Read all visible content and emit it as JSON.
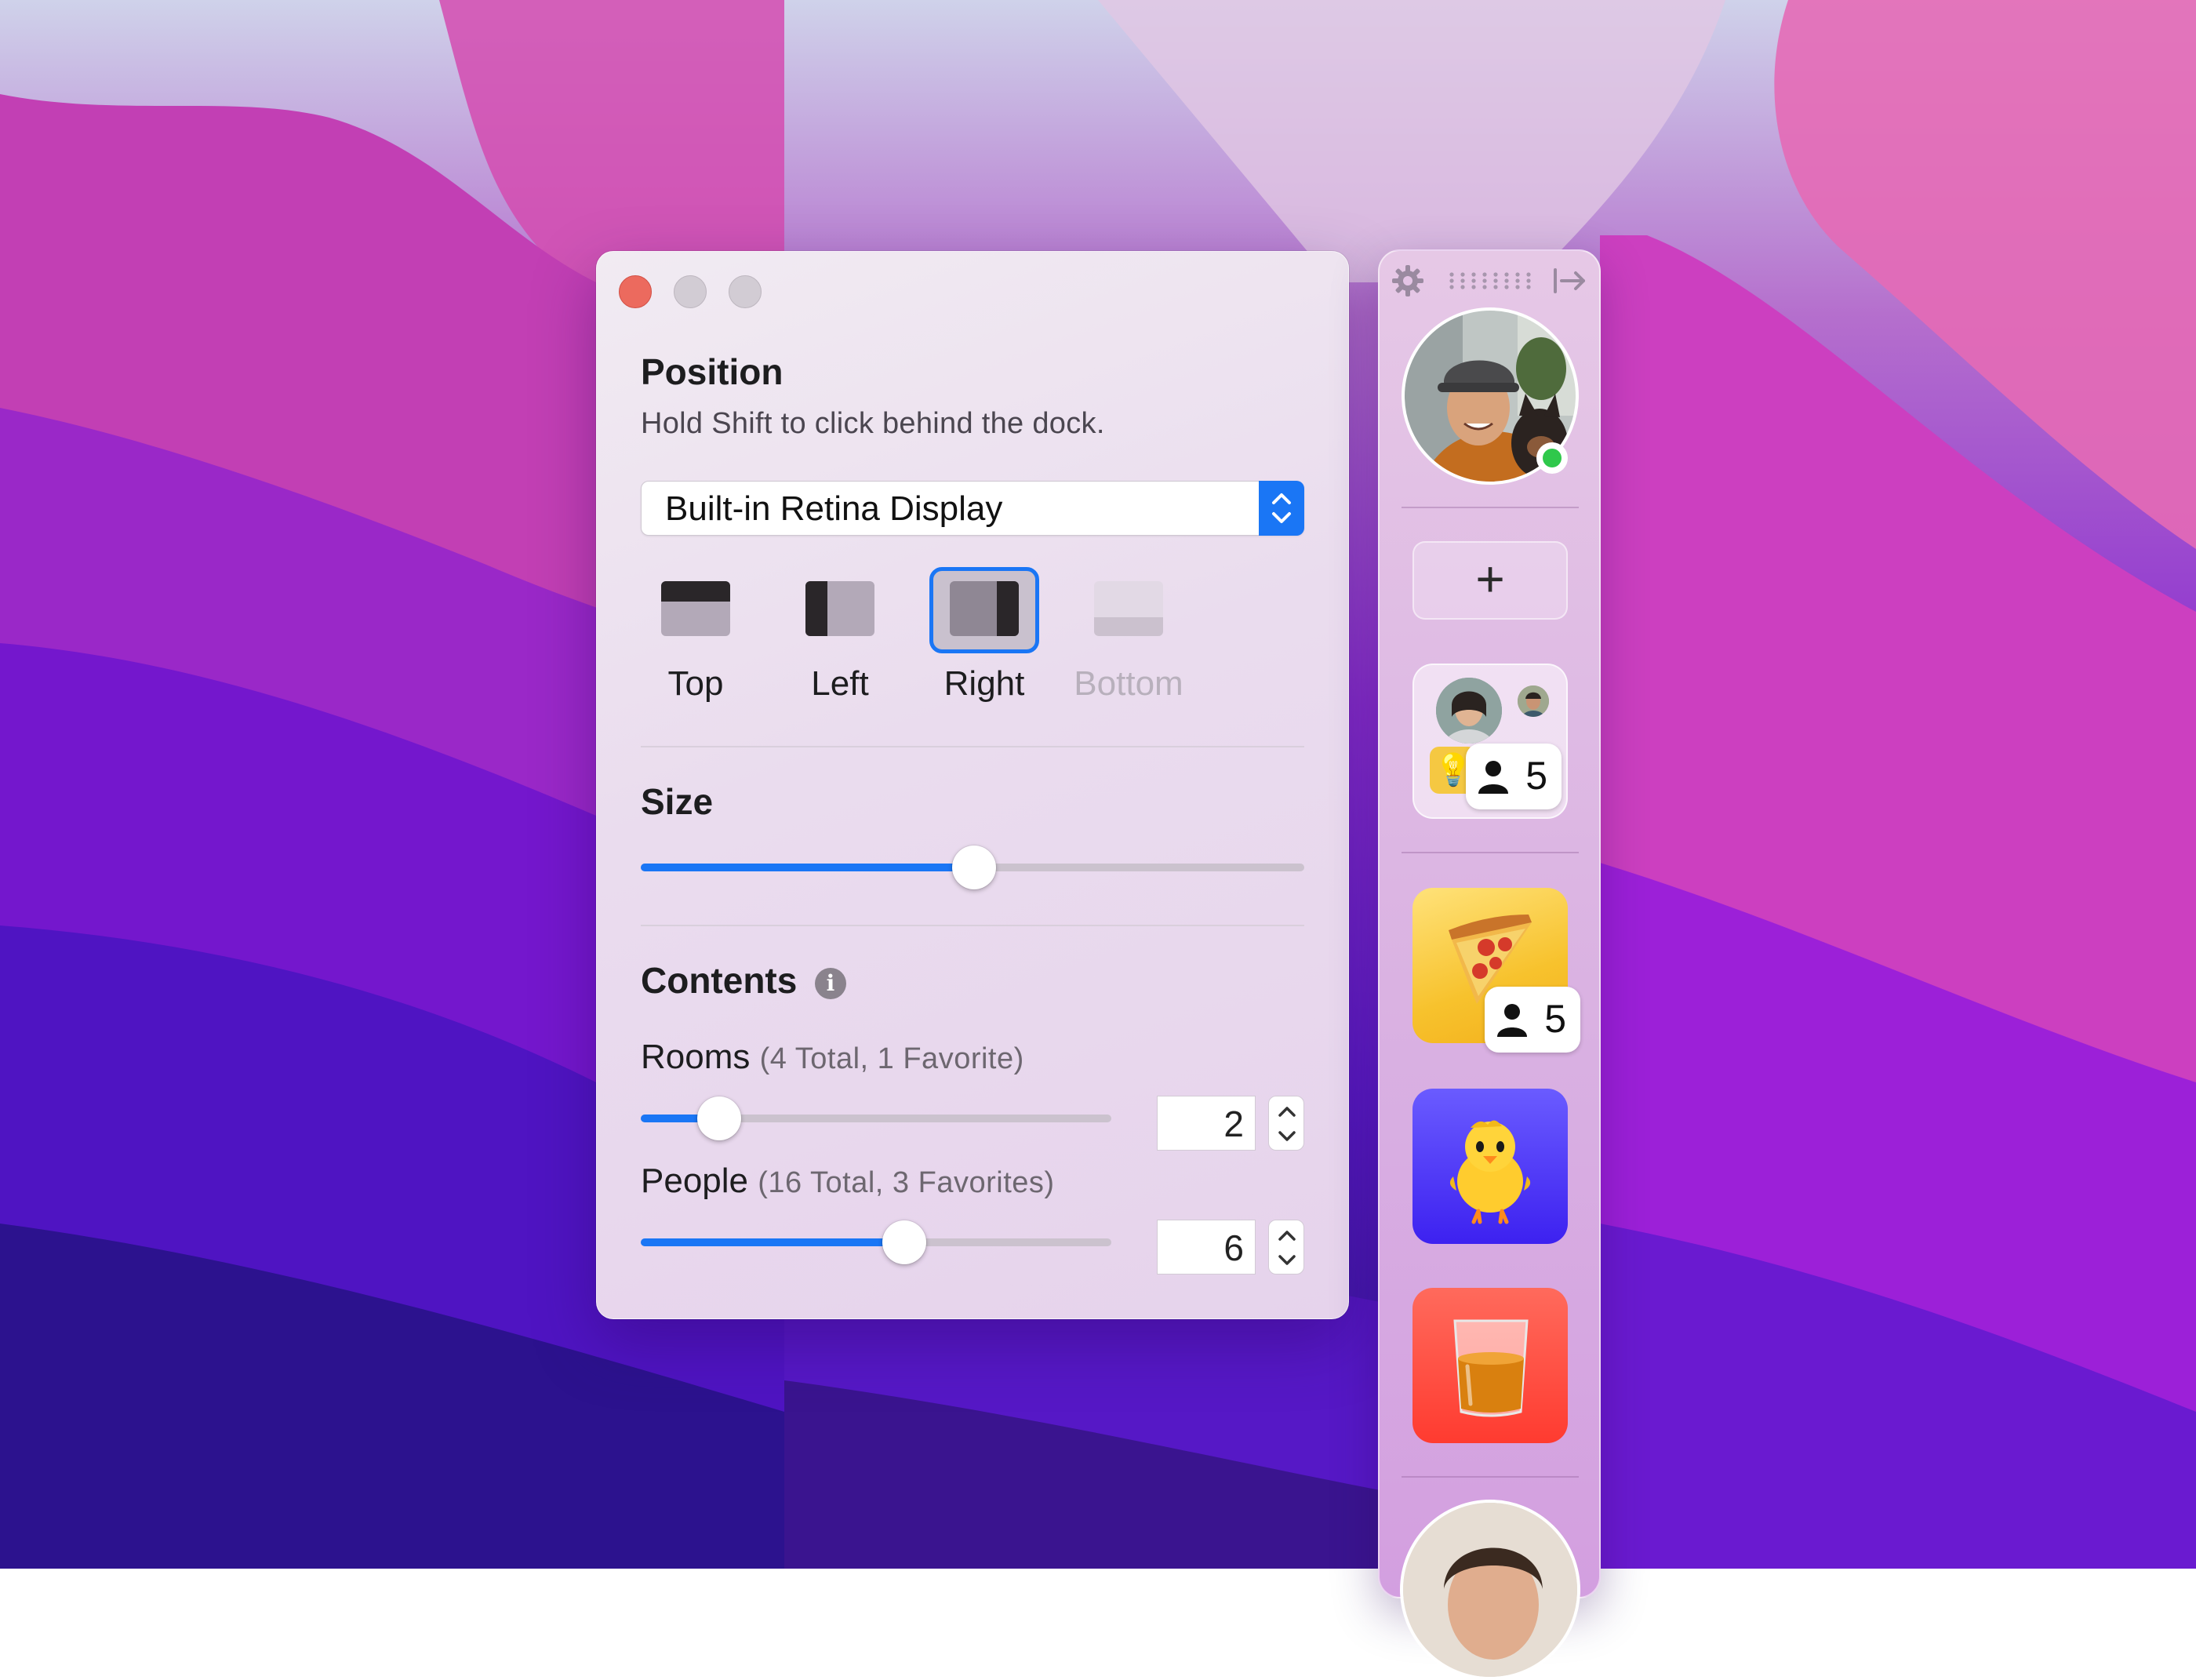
{
  "window": {
    "traffic_lights": [
      "close",
      "minimize",
      "zoom"
    ],
    "position": {
      "title": "Position",
      "subtitle": "Hold Shift to click behind the dock.",
      "display_select": "Built-in Retina Display",
      "options": [
        {
          "label": "Top",
          "state": "normal"
        },
        {
          "label": "Left",
          "state": "normal"
        },
        {
          "label": "Right",
          "state": "selected"
        },
        {
          "label": "Bottom",
          "state": "disabled"
        }
      ]
    },
    "size": {
      "title": "Size",
      "value_fraction": 0.5
    },
    "contents": {
      "title": "Contents",
      "info_icon": "info-icon",
      "rooms": {
        "label": "Rooms",
        "note": "(4 Total, 1 Favorite)",
        "value": "2",
        "slider_fraction": 0.17
      },
      "people": {
        "label": "People",
        "note": "(16 Total, 3 Favorites)",
        "value": "6",
        "slider_fraction": 0.56
      }
    }
  },
  "dock": {
    "toolbar": {
      "settings_icon": "gear-icon",
      "drag_handle": "drag-handle-icon",
      "collapse_icon": "collapse-right-icon"
    },
    "profile_status": "online",
    "add_label": "+",
    "group_room": {
      "count": "5",
      "emoji": "💡"
    },
    "rooms": [
      {
        "emoji": "🍕",
        "count": "5",
        "color": "#f7c22d"
      },
      {
        "emoji": "🐥",
        "color": "#4a30ff"
      },
      {
        "emoji": "🥃",
        "color": "#ff3b30"
      }
    ]
  },
  "colors": {
    "accent": "#1a76f5",
    "close": "#ec6a5e",
    "online": "#2fc84b"
  }
}
